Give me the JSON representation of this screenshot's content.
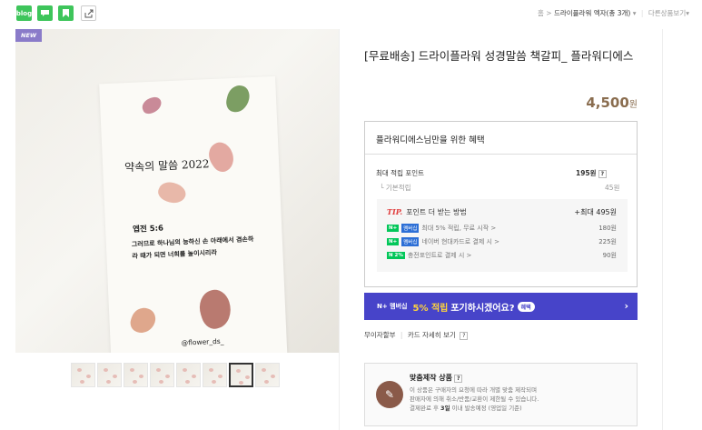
{
  "topbar": {
    "icons": [
      "naver-blog-icon",
      "talk-icon",
      "bookmark-icon",
      "share-icon"
    ],
    "blog_label": "blog",
    "breadcrumb_home": "홈",
    "breadcrumb_sep": ">",
    "breadcrumb_category": "드라이플라워 엑자(총 3개)",
    "breadcrumb_more": "다른상품보기"
  },
  "gallery": {
    "badge": "NEW",
    "card_title": "약속의 말씀 2022",
    "card_verse_ref": "엡전 5:6",
    "card_verse": "그러므로 하나님의 능하신 손 아래에서 겸손하라 때가 되면 너희를 높이시리라",
    "card_handle": "@flower_ds_",
    "thumb_count": 8,
    "active_thumb": 7
  },
  "product": {
    "title": "[무료배송] 드라이플라워 성경말씀 책갈피_ 플라워디에스",
    "price": "4,500",
    "price_unit": "원"
  },
  "benefit": {
    "heading": "플라워디에스님만을 위한 혜택",
    "max_point_label": "최대 적립 포인트",
    "max_point_value": "195원",
    "base_label": "기본적립",
    "base_value": "45원",
    "tip_label": "TIP.",
    "tip_text": "포인트 더 받는 방법",
    "tip_max": "+최대 495원",
    "rows": [
      {
        "label": "최대 5% 적립, 무료 시작 >",
        "value": "180원"
      },
      {
        "label": "네이버 현대카드로 결제 시 >",
        "value": "225원"
      },
      {
        "label": "충전포인트로 결제 시 >",
        "value": "90원"
      }
    ]
  },
  "npay": {
    "prefix": "N+ 멤버십",
    "highlight": "5% 적립",
    "text": "포기하시겠어요?",
    "tag": "혜택"
  },
  "links": {
    "interest_free": "무이자할부",
    "card_benefit": "카드 자세히 보기"
  },
  "custom": {
    "heading": "맞춤제작 상품",
    "desc1": "이 상품은 구매자의 요청에 따라 개별 맞춤 제작되며",
    "desc2": "판매자에 의해 취소/반품/교환이 제한될 수 있습니다.",
    "desc3_pre": "결제완료 후",
    "desc3_bold": "3일",
    "desc3_post": "이내 발송예정 (영업일 기준)"
  }
}
